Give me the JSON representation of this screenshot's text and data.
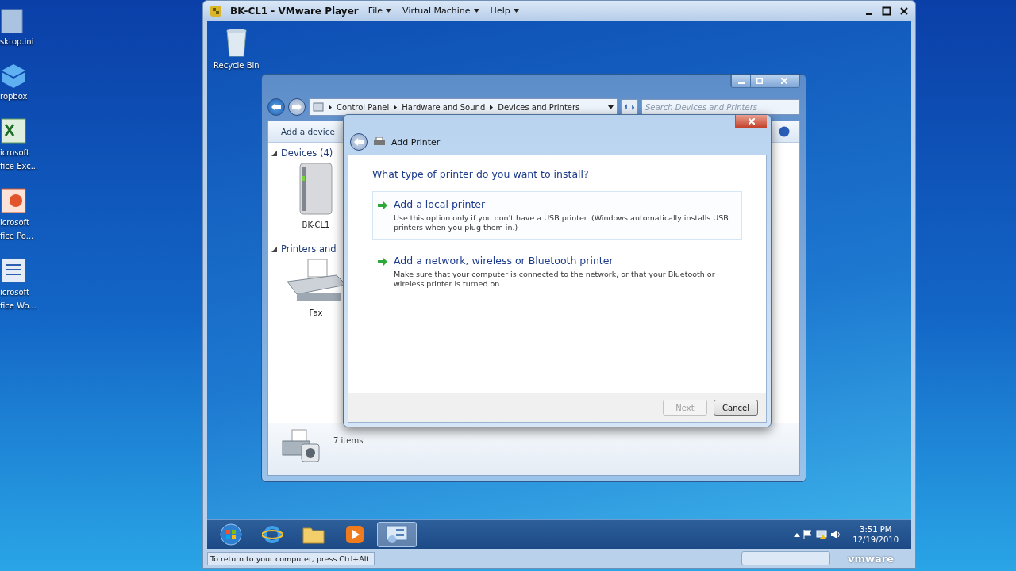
{
  "host": {
    "title": "BK-CL1 - VMware Player",
    "menus": [
      "File",
      "Virtual Machine",
      "Help"
    ],
    "desktop_icons": [
      {
        "kind": "file",
        "lines": [
          "sktop.ini"
        ]
      },
      {
        "kind": "box",
        "lines": [
          "ropbox"
        ]
      },
      {
        "kind": "sheet",
        "lines": [
          "icrosoft",
          "fice Exc..."
        ]
      },
      {
        "kind": "slides",
        "lines": [
          "icrosoft",
          "fice Po..."
        ]
      },
      {
        "kind": "doc",
        "lines": [
          "icrosoft",
          "fice Wo..."
        ]
      }
    ]
  },
  "guest_desktop_icons": [
    {
      "label": "Recycle Bin"
    }
  ],
  "explorer": {
    "breadcrumb": [
      "Control Panel",
      "Hardware and Sound",
      "Devices and Printers"
    ],
    "search": {
      "placeholder": "Search Devices and Printers"
    },
    "toolbar": [
      "Add a device"
    ],
    "groups": [
      {
        "title": "Devices (4)",
        "expanded": true,
        "items": [
          {
            "kind": "computer",
            "label": "BK-CL1"
          }
        ]
      },
      {
        "title": "Printers and",
        "expanded": true,
        "items": [
          {
            "kind": "fax",
            "label": "Fax"
          }
        ]
      }
    ],
    "status": "7 items"
  },
  "dialog": {
    "title": "Add Printer",
    "question": "What type of printer do you want to install?",
    "options": [
      {
        "title": "Add a local printer",
        "description": "Use this option only if you don't have a USB printer. (Windows automatically installs USB printers when you plug them in.)",
        "selected": true
      },
      {
        "title": "Add a network, wireless or Bluetooth printer",
        "description": "Make sure that your computer is connected to the network, or that your Bluetooth or wireless printer is turned on.",
        "selected": false
      }
    ],
    "buttons": [
      {
        "label": "Next",
        "disabled": true
      },
      {
        "label": "Cancel",
        "disabled": false
      }
    ]
  },
  "taskbar": {
    "apps": [
      {
        "kind": "start",
        "selected": false
      },
      {
        "kind": "browser",
        "selected": false
      },
      {
        "kind": "folder",
        "selected": false
      },
      {
        "kind": "media",
        "selected": false
      },
      {
        "kind": "devices",
        "selected": true
      }
    ],
    "time": "3:51 PM",
    "date": "12/19/2010"
  },
  "vm_status": {
    "hint": "To return to your computer, press Ctrl+Alt.",
    "brand": "vmware"
  }
}
